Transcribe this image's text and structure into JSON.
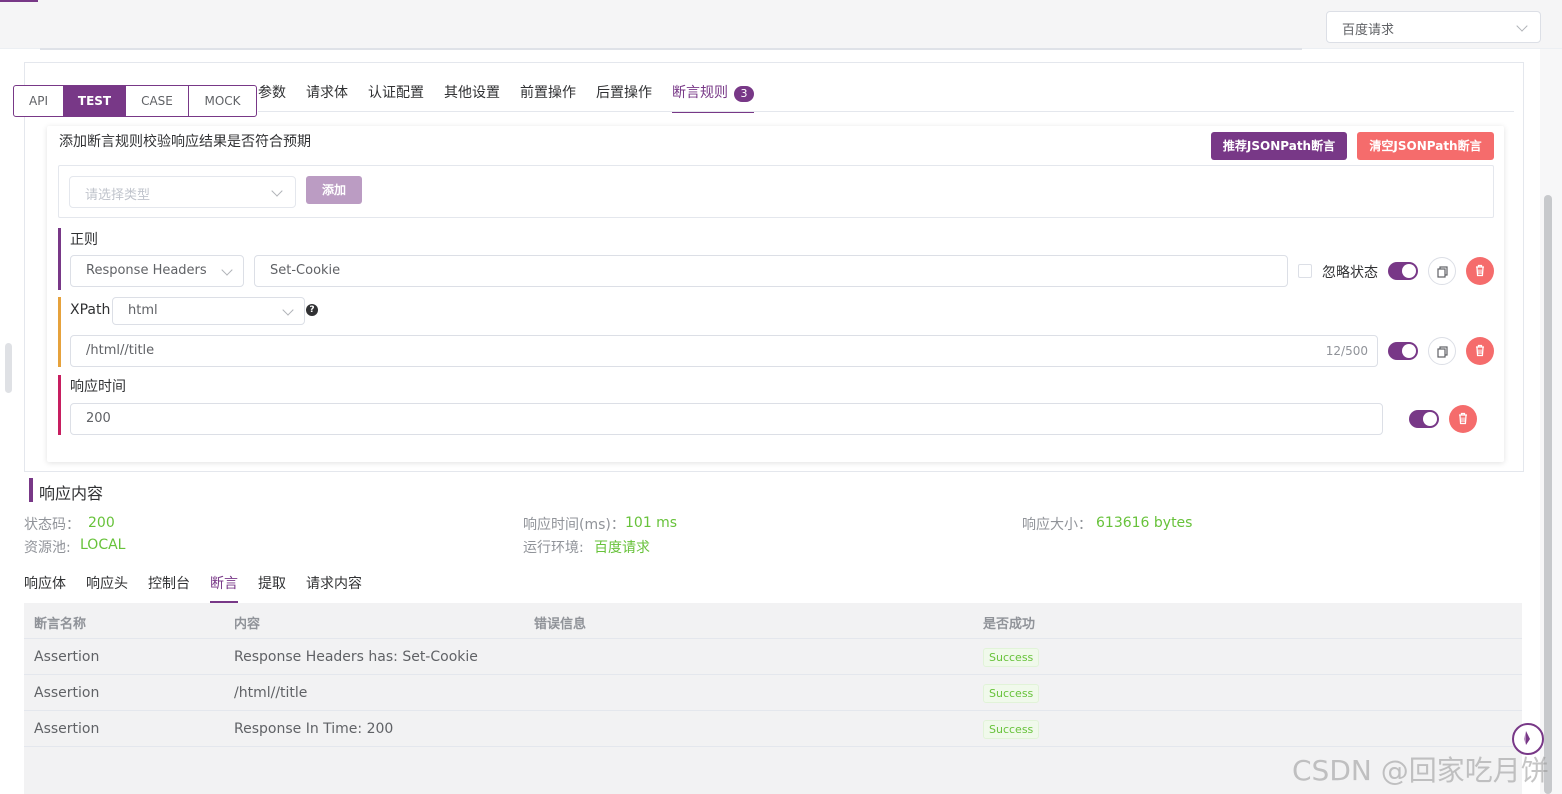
{
  "environment_select": {
    "value": "百度请求"
  },
  "mode_switch": [
    "API",
    "TEST",
    "CASE",
    "MOCK"
  ],
  "mode_active": "TEST",
  "request_tabs": [
    {
      "label": "参数"
    },
    {
      "label": "请求体"
    },
    {
      "label": "认证配置"
    },
    {
      "label": "其他设置"
    },
    {
      "label": "前置操作"
    },
    {
      "label": "后置操作"
    },
    {
      "label": "断言规则",
      "badge": "3",
      "active": true
    }
  ],
  "assertion_panel": {
    "hint": "添加断言规则校验响应结果是否符合预期",
    "recommend_button": "推荐JSONPath断言",
    "clear_button": "清空JSONPath断言",
    "type_select_placeholder": "请选择类型",
    "add_button": "添加"
  },
  "rules": {
    "regex": {
      "label": "正则",
      "subject": "Response Headers",
      "expression": "Set-Cookie",
      "ignore_status_label": "忽略状态",
      "enabled": true,
      "bar_color": "#783887"
    },
    "xpath": {
      "label": "XPath",
      "type": "html",
      "expression": "/html//title",
      "counter": "12/500",
      "enabled": true,
      "bar_color": "#e6a23c"
    },
    "response_time": {
      "label": "响应时间",
      "value": "200",
      "enabled": true,
      "bar_color": "#c71e60"
    }
  },
  "response": {
    "title": "响应内容",
    "status_code_label": "状态码：",
    "status_code": "200",
    "response_time_label": "响应时间(ms)：",
    "response_time": "101 ms",
    "response_size_label": "响应大小：",
    "response_size": "613616 bytes",
    "resource_pool_label": "资源池:",
    "resource_pool": "LOCAL",
    "run_env_label": "运行环境:",
    "run_env": "百度请求"
  },
  "response_tabs": [
    {
      "label": "响应体"
    },
    {
      "label": "响应头"
    },
    {
      "label": "控制台"
    },
    {
      "label": "断言",
      "active": true
    },
    {
      "label": "提取"
    },
    {
      "label": "请求内容"
    }
  ],
  "assertion_table": {
    "headers": [
      "断言名称",
      "内容",
      "错误信息",
      "是否成功"
    ],
    "rows": [
      {
        "name": "Assertion",
        "content": "Response Headers has: Set-Cookie",
        "error": "",
        "result": "Success"
      },
      {
        "name": "Assertion",
        "content": "/html//title",
        "error": "",
        "result": "Success"
      },
      {
        "name": "Assertion",
        "content": "Response In Time: 200",
        "error": "",
        "result": "Success"
      }
    ]
  },
  "watermark": "CSDN @回家吃月饼",
  "colors": {
    "accent": "#783887",
    "danger": "#f56c6c",
    "success": "#67c23a"
  }
}
